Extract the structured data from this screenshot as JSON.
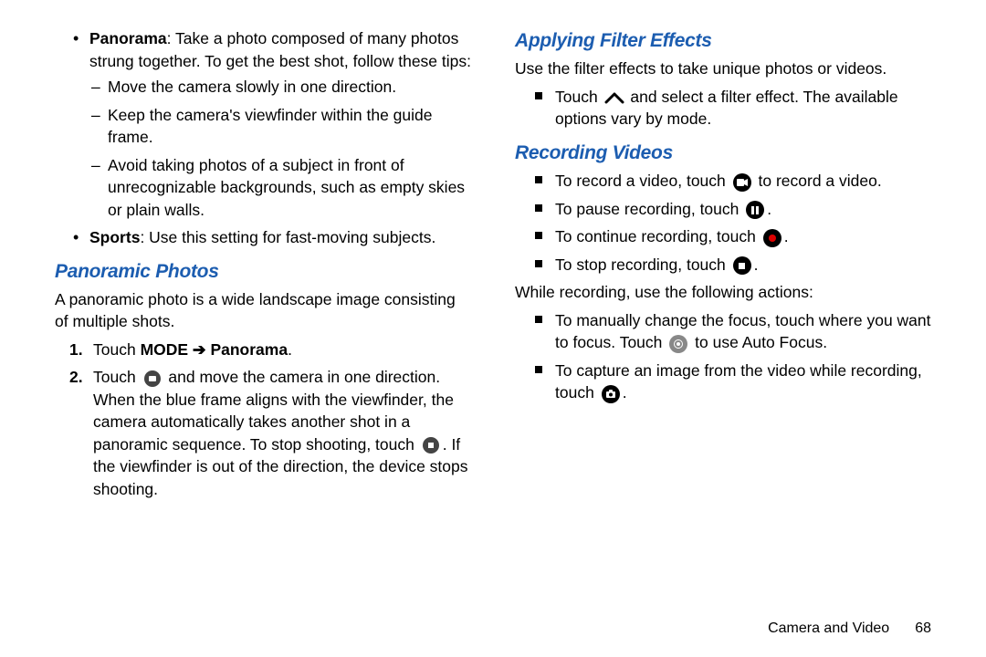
{
  "left": {
    "bullets": [
      {
        "lead": "Panorama",
        "rest": ": Take a photo composed of many photos strung together. To get the best shot, follow these tips:",
        "tips": [
          "Move the camera slowly in one direction.",
          "Keep the camera's viewfinder within the guide frame.",
          "Avoid taking photos of a subject in front of unrecognizable backgrounds, such as empty skies or plain walls."
        ]
      },
      {
        "lead": "Sports",
        "rest": ": Use this setting for fast-moving subjects."
      }
    ],
    "heading": "Panoramic Photos",
    "intro": "A panoramic photo is a wide landscape image consisting of multiple shots.",
    "step1_a": "Touch ",
    "step1_b": "MODE ➔ Panorama",
    "step1_c": ".",
    "step2_a": "Touch ",
    "step2_b": " and move the camera in one direction. When the blue frame aligns with the viewfinder, the camera automatically takes another shot in a panoramic sequence. To stop shooting, touch ",
    "step2_c": ". If the viewfinder is out of the direction, the device stops shooting."
  },
  "right": {
    "heading1": "Applying Filter Effects",
    "filter_intro": "Use the filter effects to take unique photos or videos.",
    "filter_a": "Touch ",
    "filter_b": " and select a filter effect. The available options vary by mode.",
    "heading2": "Recording Videos",
    "rec1_a": "To record a video, touch ",
    "rec1_b": " to record a video.",
    "rec2_a": "To pause recording, touch ",
    "rec2_b": ".",
    "rec3_a": "To continue recording, touch ",
    "rec3_b": ".",
    "rec4_a": "To stop recording, touch ",
    "rec4_b": ".",
    "while": "While recording, use the following actions:",
    "focus_a": "To manually change the focus, touch where you want to focus. Touch ",
    "focus_b": " to use Auto Focus.",
    "capture_a": "To capture an image from the video while recording, touch ",
    "capture_b": "."
  },
  "footer": {
    "section": "Camera and Video",
    "page": "68"
  }
}
